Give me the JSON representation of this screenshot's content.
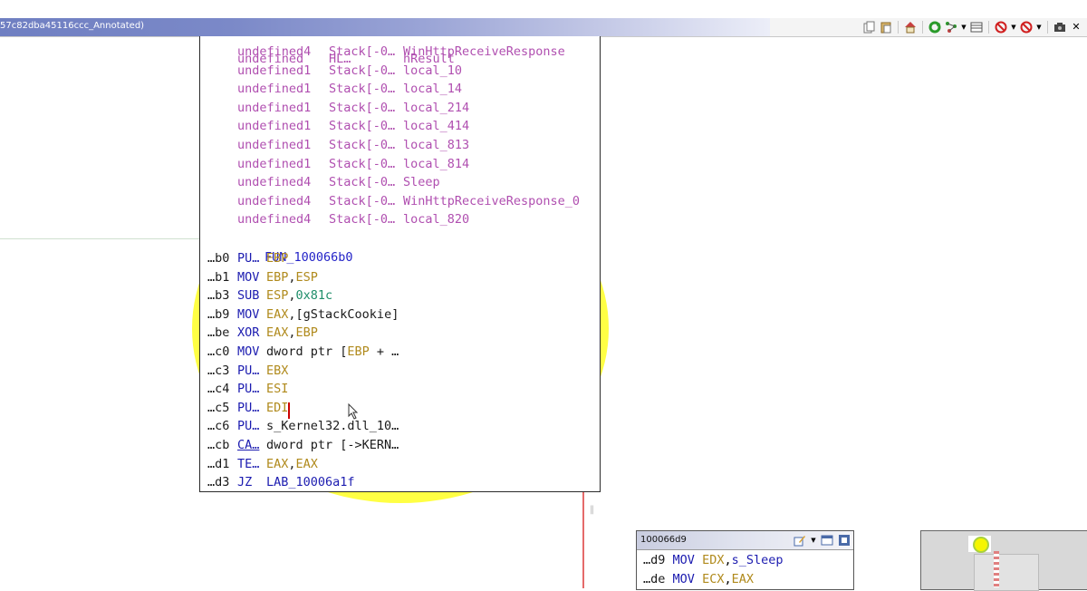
{
  "window": {
    "title": "57c82dba45116ccc_Annotated)"
  },
  "toolbar": {
    "icons": [
      "copy-icon",
      "paste-icon",
      "home-icon",
      "refresh-icon",
      "graph-layout-icon",
      "dropdown-arrow",
      "table-icon",
      "no-entry-icon",
      "dropdown-arrow",
      "no-entry-icon",
      "dropdown-arrow",
      "camera-icon",
      "close-icon"
    ]
  },
  "popup": {
    "vars": [
      {
        "type": "undefined4",
        "stack": "Stack[-0…",
        "name": "WinHttpReceiveResponse"
      },
      {
        "type": "undefined1",
        "stack": "Stack[-0…",
        "name": "local_10"
      },
      {
        "type": "undefined1",
        "stack": "Stack[-0…",
        "name": "local_14"
      },
      {
        "type": "undefined1",
        "stack": "Stack[-0…",
        "name": "local_214"
      },
      {
        "type": "undefined1",
        "stack": "Stack[-0…",
        "name": "local_414"
      },
      {
        "type": "undefined1",
        "stack": "Stack[-0…",
        "name": "local_813"
      },
      {
        "type": "undefined1",
        "stack": "Stack[-0…",
        "name": "local_814"
      },
      {
        "type": "undefined4",
        "stack": "Stack[-0…",
        "name": "Sleep"
      },
      {
        "type": "undefined4",
        "stack": "Stack[-0…",
        "name": "WinHttpReceiveResponse_0"
      },
      {
        "type": "undefined4",
        "stack": "Stack[-0…",
        "name": "local_820"
      }
    ],
    "function_label": "FUN_100066b0",
    "instructions": [
      {
        "addr": "…b0",
        "mnem": "PU…",
        "op1": "EBP",
        "sep": "",
        "op2": ""
      },
      {
        "addr": "…b1",
        "mnem": "MOV",
        "op1": "EBP",
        "sep": ",",
        "op2": "ESP"
      },
      {
        "addr": "…b3",
        "mnem": "SUB",
        "op1": "ESP",
        "sep": ",",
        "op2": "0x81c"
      },
      {
        "addr": "…b9",
        "mnem": "MOV",
        "op1": "EAX",
        "sep": ",",
        "op2": "[gStackCookie]"
      },
      {
        "addr": "…be",
        "mnem": "XOR",
        "op1": "EAX",
        "sep": ",",
        "op2": "EBP"
      },
      {
        "addr": "…c0",
        "mnem": "MOV",
        "op1": "dword ptr [",
        "sep": "EBP",
        "op2": " + …"
      },
      {
        "addr": "…c3",
        "mnem": "PU…",
        "op1": "EBX",
        "sep": "",
        "op2": ""
      },
      {
        "addr": "…c4",
        "mnem": "PU…",
        "op1": "ESI",
        "sep": "",
        "op2": ""
      },
      {
        "addr": "…c5",
        "mnem": "PU…",
        "op1": "EDI",
        "sep": "",
        "op2": ""
      },
      {
        "addr": "…c6",
        "mnem": "PU…",
        "op1": "s_Kernel32.dll_10…",
        "sep": "",
        "op2": ""
      },
      {
        "addr": "…cb",
        "mnem": "CA…",
        "op1": "dword ptr [->KERN…",
        "sep": "",
        "op2": ""
      },
      {
        "addr": "…d1",
        "mnem": "TE…",
        "op1": "EAX",
        "sep": ",",
        "op2": "EAX"
      },
      {
        "addr": "…d3",
        "mnem": "JZ",
        "op1": "LAB_10006a1f",
        "sep": "",
        "op2": ""
      }
    ]
  },
  "mini_block": {
    "title": "100066d9",
    "lines": [
      {
        "addr": "…d9",
        "mnem": "MOV",
        "op1": "EDX",
        "sep": ",",
        "op2": "s_Sleep"
      },
      {
        "addr": "…de",
        "mnem": "MOV",
        "op1": "ECX",
        "sep": ",",
        "op2": "EAX"
      }
    ]
  },
  "edge_mark": "‖",
  "colors": {
    "title_bar": "#6f7fc2",
    "highlight": "#ffff44",
    "edge": "#e56a6a",
    "var_text": "#b04fb0",
    "register": "#b08a1c",
    "immediate": "#1f8e6a",
    "mnemonic": "#1c1cb0"
  }
}
